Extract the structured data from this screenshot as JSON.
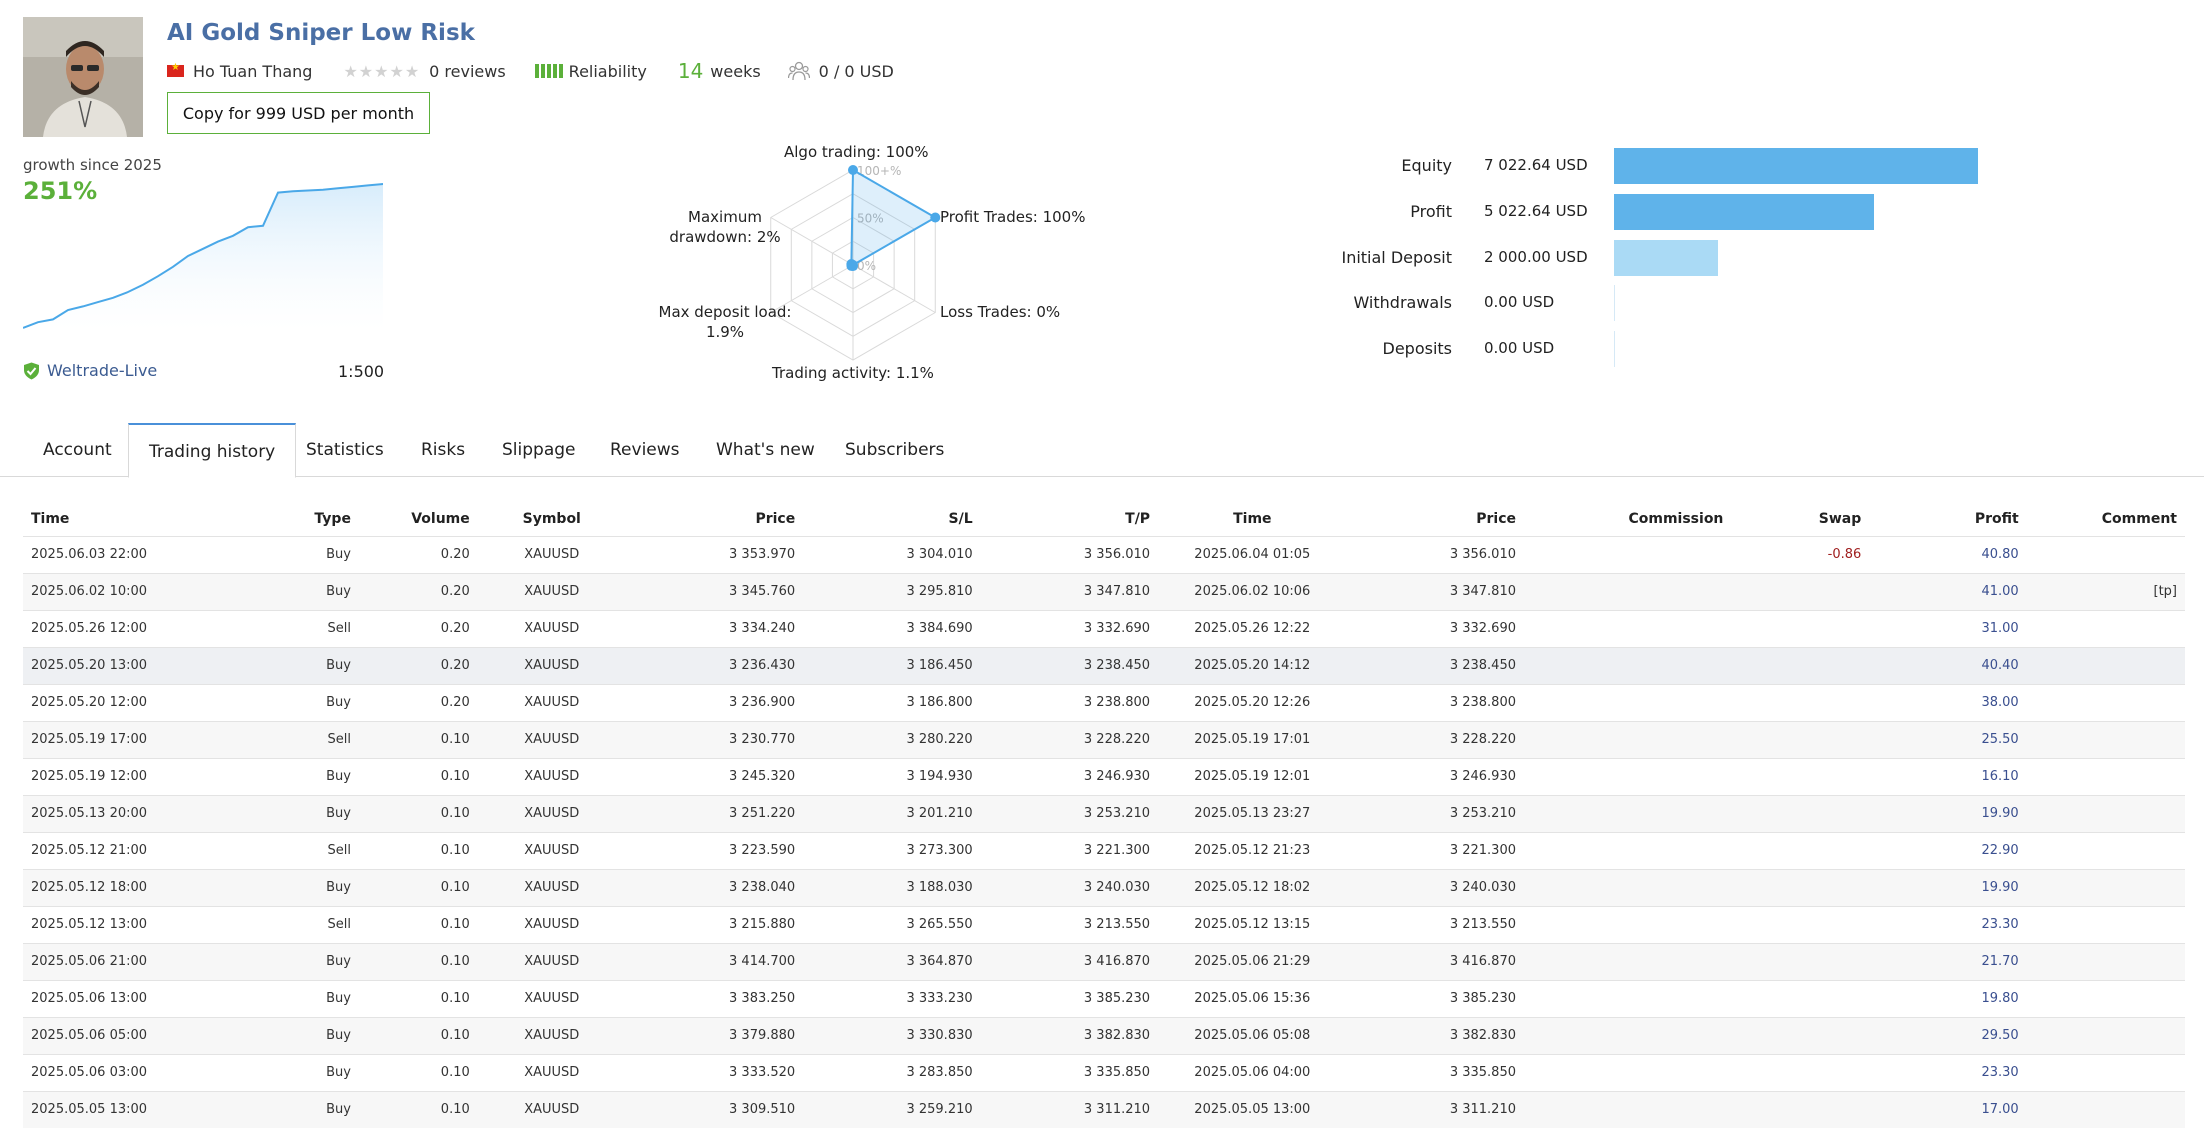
{
  "header": {
    "title": "AI Gold Sniper Low Risk",
    "author": "Ho Tuan Thang",
    "reviews": "0 reviews",
    "reliability": "Reliability",
    "weeks_num": "14",
    "weeks_label": "weeks",
    "subscribers": "0 / 0 USD",
    "copy_button": "Copy for 999 USD per month",
    "rating_stars": 0
  },
  "growth": {
    "label": "growth since 2025",
    "value": "251%",
    "broker": "Weltrade-Live",
    "leverage": "1:500",
    "curve": [
      0,
      8,
      12,
      25,
      30,
      36,
      42,
      50,
      60,
      72,
      85,
      100,
      110,
      120,
      128,
      140,
      142,
      188,
      190,
      191,
      192,
      194,
      196,
      198,
      200
    ]
  },
  "radar": {
    "labels": {
      "algo": "Algo trading: 100%",
      "profit": "Profit Trades: 100%",
      "loss": "Loss Trades: 0%",
      "activity": "Trading activity: 1.1%",
      "deposit_load_1": "Max deposit load:",
      "deposit_load_2": "1.9%",
      "drawdown_1": "Maximum",
      "drawdown_2": "drawdown: 2%"
    },
    "scale": {
      "p100": "100+%",
      "p50": "50%",
      "p0": "0%"
    },
    "values": [
      1.0,
      1.0,
      0.0,
      0.011,
      0.019,
      0.02
    ],
    "accent": "#4aa8e8"
  },
  "finance": [
    {
      "label": "Equity",
      "value": "7 022.64 USD",
      "amount": 7022.64,
      "color": "#5fb3ea"
    },
    {
      "label": "Profit",
      "value": "5 022.64 USD",
      "amount": 5022.64,
      "color": "#5fb3ea"
    },
    {
      "label": "Initial Deposit",
      "value": "2 000.00 USD",
      "amount": 2000.0,
      "color": "#aadaf5"
    },
    {
      "label": "Withdrawals",
      "value": "0.00 USD",
      "amount": 0,
      "color": "#aadaf5"
    },
    {
      "label": "Deposits",
      "value": "0.00 USD",
      "amount": 0,
      "color": "#aadaf5"
    }
  ],
  "tabs": [
    "Account",
    "Trading history",
    "Statistics",
    "Risks",
    "Slippage",
    "Reviews",
    "What's new",
    "Subscribers"
  ],
  "active_tab": 1,
  "table": {
    "headers": [
      "Time",
      "Type",
      "Volume",
      "Symbol",
      "Price",
      "S/L",
      "T/P",
      "Time",
      "Price",
      "Commission",
      "Swap",
      "Profit",
      "Comment"
    ],
    "rows": [
      [
        "2025.06.03 22:00",
        "Buy",
        "0.20",
        "XAUUSD",
        "3 353.970",
        "3 304.010",
        "3 356.010",
        "2025.06.04 01:05",
        "3 356.010",
        "",
        "-0.86",
        "40.80",
        ""
      ],
      [
        "2025.06.02 10:00",
        "Buy",
        "0.20",
        "XAUUSD",
        "3 345.760",
        "3 295.810",
        "3 347.810",
        "2025.06.02 10:06",
        "3 347.810",
        "",
        "",
        "41.00",
        "[tp]"
      ],
      [
        "2025.05.26 12:00",
        "Sell",
        "0.20",
        "XAUUSD",
        "3 334.240",
        "3 384.690",
        "3 332.690",
        "2025.05.26 12:22",
        "3 332.690",
        "",
        "",
        "31.00",
        ""
      ],
      [
        "2025.05.20 13:00",
        "Buy",
        "0.20",
        "XAUUSD",
        "3 236.430",
        "3 186.450",
        "3 238.450",
        "2025.05.20 14:12",
        "3 238.450",
        "",
        "",
        "40.40",
        ""
      ],
      [
        "2025.05.20 12:00",
        "Buy",
        "0.20",
        "XAUUSD",
        "3 236.900",
        "3 186.800",
        "3 238.800",
        "2025.05.20 12:26",
        "3 238.800",
        "",
        "",
        "38.00",
        ""
      ],
      [
        "2025.05.19 17:00",
        "Sell",
        "0.10",
        "XAUUSD",
        "3 230.770",
        "3 280.220",
        "3 228.220",
        "2025.05.19 17:01",
        "3 228.220",
        "",
        "",
        "25.50",
        ""
      ],
      [
        "2025.05.19 12:00",
        "Buy",
        "0.10",
        "XAUUSD",
        "3 245.320",
        "3 194.930",
        "3 246.930",
        "2025.05.19 12:01",
        "3 246.930",
        "",
        "",
        "16.10",
        ""
      ],
      [
        "2025.05.13 20:00",
        "Buy",
        "0.10",
        "XAUUSD",
        "3 251.220",
        "3 201.210",
        "3 253.210",
        "2025.05.13 23:27",
        "3 253.210",
        "",
        "",
        "19.90",
        ""
      ],
      [
        "2025.05.12 21:00",
        "Sell",
        "0.10",
        "XAUUSD",
        "3 223.590",
        "3 273.300",
        "3 221.300",
        "2025.05.12 21:23",
        "3 221.300",
        "",
        "",
        "22.90",
        ""
      ],
      [
        "2025.05.12 18:00",
        "Buy",
        "0.10",
        "XAUUSD",
        "3 238.040",
        "3 188.030",
        "3 240.030",
        "2025.05.12 18:02",
        "3 240.030",
        "",
        "",
        "19.90",
        ""
      ],
      [
        "2025.05.12 13:00",
        "Sell",
        "0.10",
        "XAUUSD",
        "3 215.880",
        "3 265.550",
        "3 213.550",
        "2025.05.12 13:15",
        "3 213.550",
        "",
        "",
        "23.30",
        ""
      ],
      [
        "2025.05.06 21:00",
        "Buy",
        "0.10",
        "XAUUSD",
        "3 414.700",
        "3 364.870",
        "3 416.870",
        "2025.05.06 21:29",
        "3 416.870",
        "",
        "",
        "21.70",
        ""
      ],
      [
        "2025.05.06 13:00",
        "Buy",
        "0.10",
        "XAUUSD",
        "3 383.250",
        "3 333.230",
        "3 385.230",
        "2025.05.06 15:36",
        "3 385.230",
        "",
        "",
        "19.80",
        ""
      ],
      [
        "2025.05.06 05:00",
        "Buy",
        "0.10",
        "XAUUSD",
        "3 379.880",
        "3 330.830",
        "3 382.830",
        "2025.05.06 05:08",
        "3 382.830",
        "",
        "",
        "29.50",
        ""
      ],
      [
        "2025.05.06 03:00",
        "Buy",
        "0.10",
        "XAUUSD",
        "3 333.520",
        "3 283.850",
        "3 335.850",
        "2025.05.06 04:00",
        "3 335.850",
        "",
        "",
        "23.30",
        ""
      ],
      [
        "2025.05.05 13:00",
        "Buy",
        "0.10",
        "XAUUSD",
        "3 309.510",
        "3 259.210",
        "3 311.210",
        "2025.05.05 13:00",
        "3 311.210",
        "",
        "",
        "17.00",
        ""
      ]
    ],
    "highlighted_row": 3
  }
}
